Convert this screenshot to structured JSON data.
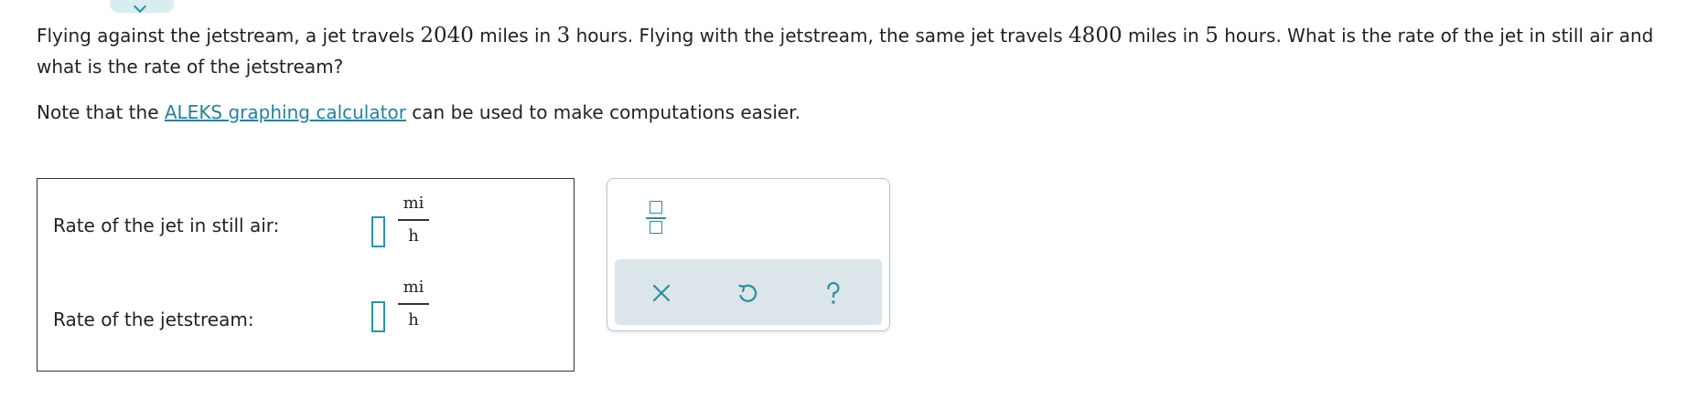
{
  "problem": {
    "p1": "Flying against the jetstream, a jet travels ",
    "n1": "2040",
    "p2": " miles in ",
    "n2": "3",
    "p3": " hours. Flying with the jetstream, the same jet travels ",
    "n3": "4800",
    "p4": " miles in ",
    "n4": "5",
    "p5": " hours. What is the rate of the jet in still air and what is the rate of the jetstream?"
  },
  "note": {
    "before": "Note that the ",
    "link": "ALEKS graphing calculator",
    "after": " can be used to make computations easier."
  },
  "answers": [
    {
      "label": "Rate of the jet in still air:",
      "value": "",
      "unit_num": "mi",
      "unit_den": "h"
    },
    {
      "label": "Rate of the jetstream:",
      "value": "",
      "unit_num": "mi",
      "unit_den": "h"
    }
  ],
  "toolbox": {
    "tools": [
      "fraction-icon"
    ],
    "actions": [
      "close-icon",
      "undo-icon",
      "question-icon"
    ]
  },
  "colors": {
    "accent": "#2a8fa0",
    "link": "#2a7f9c",
    "input_border": "#2a92b8",
    "toolbar_bg": "#dce5ea"
  }
}
